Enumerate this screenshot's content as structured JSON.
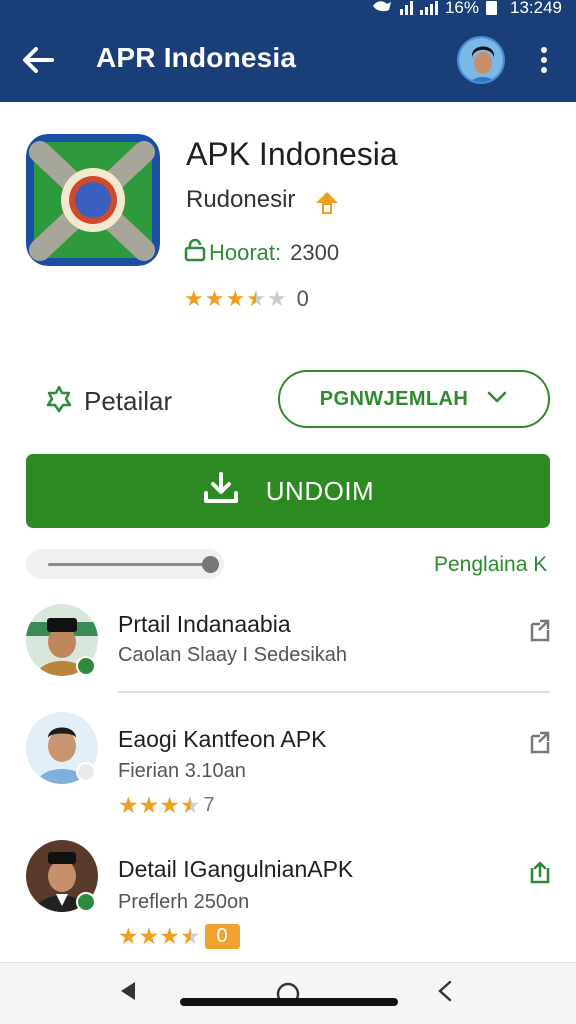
{
  "status_bar": {
    "battery": "16%",
    "time": "13:249"
  },
  "app_bar": {
    "title": "APR Indonesia"
  },
  "app": {
    "name": "APK Indonesia",
    "developer": "Rudonesir",
    "hoorat_label": "Hoorat:",
    "hoorat_count": "2300",
    "rating": 3.5,
    "rating_count": "0"
  },
  "actions": {
    "detail_label": "Petailar",
    "dropdown_label": "PGNWJEMLAH",
    "download_label": "UNDOIM",
    "slider_value": 0.95,
    "section_link": "Penglaina K"
  },
  "list": [
    {
      "title": "Prtail Indanaabia",
      "subtitle": "Caolan Slaay I Sedesikah",
      "online": true
    },
    {
      "title": "Eaogi Kantfeon APK",
      "subtitle": "Fierian 3.10an",
      "rating": 3.5,
      "rating_count": "7",
      "online": false
    },
    {
      "title": "Detail IGangulnianAPK",
      "subtitle": "Preflerh 250on",
      "rating": 3.5,
      "rating_count": "0",
      "online": true
    }
  ],
  "colors": {
    "primary": "#1a3e78",
    "accent_green": "#2d8a22",
    "star": "#f0a020"
  }
}
